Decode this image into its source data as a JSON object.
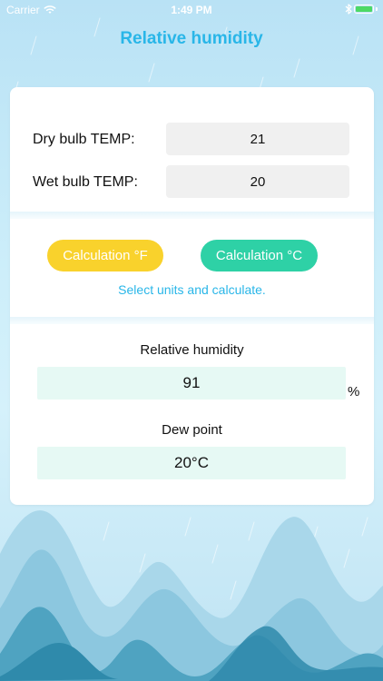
{
  "status_bar": {
    "carrier": "Carrier",
    "time": "1:49 PM",
    "wifi_icon": "wifi-icon",
    "bluetooth_icon": "bluetooth-icon",
    "battery_icon": "battery-icon",
    "battery_color": "#4cd964"
  },
  "header": {
    "title": "Relative humidity",
    "title_color": "#29b6e8"
  },
  "inputs": {
    "dry_label": "Dry bulb TEMP:",
    "dry_value": "21",
    "wet_label": "Wet bulb TEMP:",
    "wet_value": "20"
  },
  "actions": {
    "calc_f_label": "Calculation °F",
    "calc_c_label": "Calculation °C",
    "hint": "Select units and calculate.",
    "calc_f_color": "#f9d22c",
    "calc_c_color": "#2ed1a6"
  },
  "results": {
    "rh_label": "Relative humidity",
    "rh_value": "91",
    "rh_unit": "%",
    "dew_label": "Dew point",
    "dew_value": "20°C"
  }
}
